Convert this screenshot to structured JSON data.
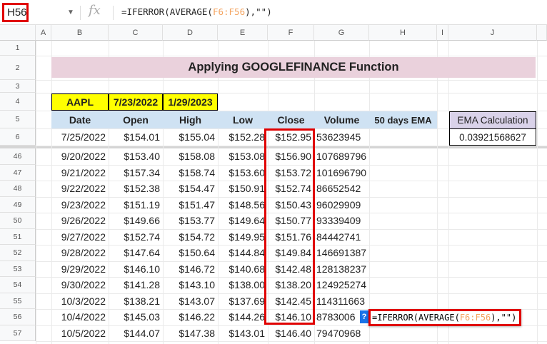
{
  "name_box": "H56",
  "formula": {
    "prefix": "=IFERROR(AVERAGE(",
    "ref": "F6:F56",
    "suffix": "),\"\")"
  },
  "columns": [
    "A",
    "B",
    "C",
    "D",
    "E",
    "F",
    "G",
    "H",
    "I",
    "J"
  ],
  "title": "Applying GOOGLEFINANCE Function",
  "params": {
    "ticker": "AAPL",
    "start": "7/23/2022",
    "end": "1/29/2023"
  },
  "headers": [
    "Date",
    "Open",
    "High",
    "Low",
    "Close",
    "Volume",
    "50 days EMA"
  ],
  "ema_calc": {
    "label": "EMA Calculation",
    "value": "0.03921568627"
  },
  "rows": [
    {
      "n": "6",
      "date": "7/25/2022",
      "open": "$154.01",
      "high": "$155.04",
      "low": "$152.28",
      "close": "$152.95",
      "volume": "53623945"
    },
    {
      "n": "46",
      "date": "9/20/2022",
      "open": "$153.40",
      "high": "$158.08",
      "low": "$153.08",
      "close": "$156.90",
      "volume": "107689796"
    },
    {
      "n": "47",
      "date": "9/21/2022",
      "open": "$157.34",
      "high": "$158.74",
      "low": "$153.60",
      "close": "$153.72",
      "volume": "101696790"
    },
    {
      "n": "48",
      "date": "9/22/2022",
      "open": "$152.38",
      "high": "$154.47",
      "low": "$150.91",
      "close": "$152.74",
      "volume": "86652542"
    },
    {
      "n": "49",
      "date": "9/23/2022",
      "open": "$151.19",
      "high": "$151.47",
      "low": "$148.56",
      "close": "$150.43",
      "volume": "96029909"
    },
    {
      "n": "50",
      "date": "9/26/2022",
      "open": "$149.66",
      "high": "$153.77",
      "low": "$149.64",
      "close": "$150.77",
      "volume": "93339409"
    },
    {
      "n": "51",
      "date": "9/27/2022",
      "open": "$152.74",
      "high": "$154.72",
      "low": "$149.95",
      "close": "$151.76",
      "volume": "84442741"
    },
    {
      "n": "52",
      "date": "9/28/2022",
      "open": "$147.64",
      "high": "$150.64",
      "low": "$144.84",
      "close": "$149.84",
      "volume": "146691387"
    },
    {
      "n": "53",
      "date": "9/29/2022",
      "open": "$146.10",
      "high": "$146.72",
      "low": "$140.68",
      "close": "$142.48",
      "volume": "128138237"
    },
    {
      "n": "54",
      "date": "9/30/2022",
      "open": "$141.28",
      "high": "$143.10",
      "low": "$138.00",
      "close": "$138.20",
      "volume": "124925274"
    },
    {
      "n": "55",
      "date": "10/3/2022",
      "open": "$138.21",
      "high": "$143.07",
      "low": "$137.69",
      "close": "$142.45",
      "volume": "114311663"
    },
    {
      "n": "56",
      "date": "10/4/2022",
      "open": "$145.03",
      "high": "$146.22",
      "low": "$144.26",
      "close": "$146.10",
      "volume": "8783006"
    },
    {
      "n": "57",
      "date": "10/5/2022",
      "open": "$144.07",
      "high": "$147.38",
      "low": "$143.01",
      "close": "$146.40",
      "volume": "79470968"
    }
  ],
  "top_rows": [
    "1",
    "2",
    "3",
    "4",
    "5"
  ],
  "editor_help": "?",
  "colors": {
    "title_bg": "#ead1dc",
    "param_bg": "#ffff00",
    "header_bg": "#cfe2f3",
    "ema_bg": "#d9d2e9",
    "highlight": "#e00000"
  }
}
